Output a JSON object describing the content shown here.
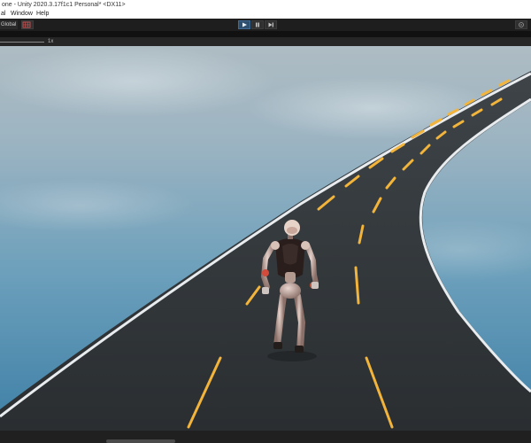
{
  "window": {
    "title": "one - Unity 2020.3.17f1c1 Personal* <DX11>"
  },
  "menu": {
    "items": [
      "al",
      "Window",
      "Help"
    ]
  },
  "toolbar": {
    "space_label": "Global",
    "play_icon": "play-icon",
    "pause_icon": "pause-icon",
    "step_icon": "step-icon",
    "cloud_icon": "cloud-icon"
  },
  "game_view": {
    "scale_label": "1x"
  },
  "colors": {
    "editor_dark": "#191919",
    "toolbar": "#1e1e1e",
    "play_active": "#2f4f6e",
    "road": "#2e3236",
    "road_edge": "#e8ecef",
    "lane_marking": "#f2b43a",
    "sky_top": "#aebcc3",
    "sky_bottom": "#3e7fa6"
  }
}
